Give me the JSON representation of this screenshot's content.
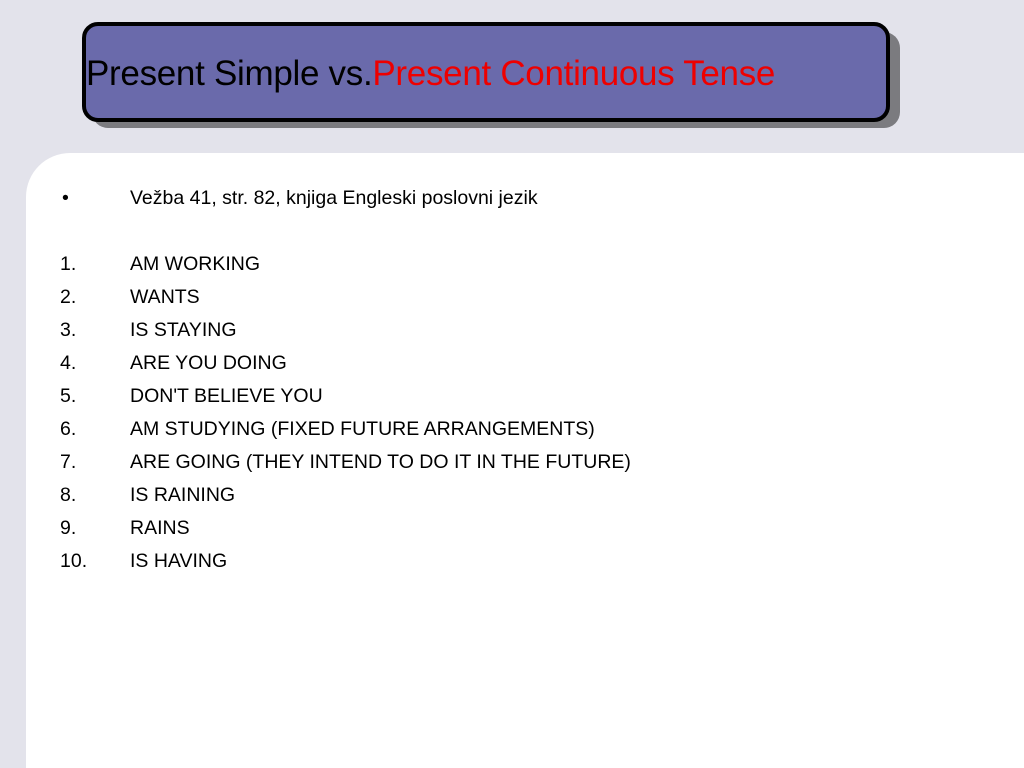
{
  "slide": {
    "title": {
      "part_plain": "Present Simple vs.",
      "part_accent": "Present Continuous Tense"
    },
    "colors": {
      "background": "#e3e3eb",
      "title_box_fill": "#6a6aab",
      "title_accent": "#ee0000",
      "content_panel": "#ffffff"
    },
    "intro": {
      "marker": "•",
      "text": "Vežba 41, str. 82, knjiga Engleski poslovni jezik"
    },
    "answers": [
      {
        "number": "1.",
        "text": "AM WORKING"
      },
      {
        "number": "2.",
        "text": "WANTS"
      },
      {
        "number": "3.",
        "text": "IS STAYING"
      },
      {
        "number": "4.",
        "text": "ARE YOU DOING"
      },
      {
        "number": "5.",
        "text": "DON'T BELIEVE YOU"
      },
      {
        "number": "6.",
        "text": "AM STUDYING (FIXED FUTURE ARRANGEMENTS)"
      },
      {
        "number": "7.",
        "text": "ARE GOING (THEY INTEND TO DO IT IN THE FUTURE)"
      },
      {
        "number": "8.",
        "text": "IS RAINING"
      },
      {
        "number": "9.",
        "text": "RAINS"
      },
      {
        "number": "10.",
        "text": "IS HAVING"
      }
    ]
  }
}
